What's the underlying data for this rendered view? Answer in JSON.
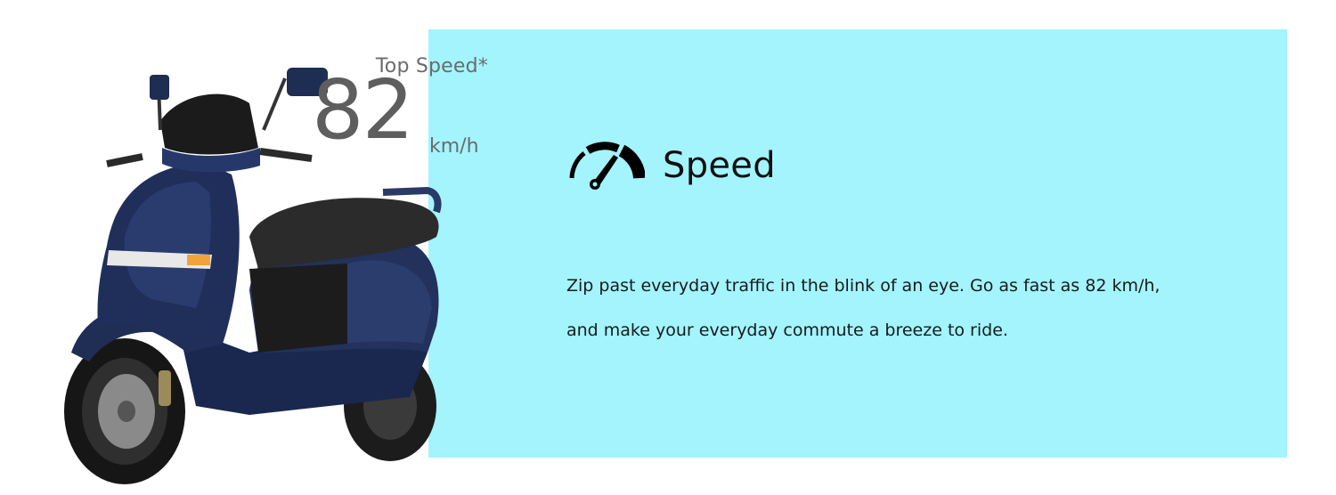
{
  "colors": {
    "panel": "#a3f4fd",
    "scooter_body": "#1e2d52",
    "seat": "#2a2a2a",
    "value_text": "#5e5e5e"
  },
  "stat": {
    "label": "Top Speed*",
    "value": "82",
    "unit": "km/h"
  },
  "feature": {
    "icon": "speedometer-icon",
    "title": "Speed",
    "description_line1": "Zip past everyday traffic in the blink of an eye. Go as  fast as 82 km/h,",
    "description_line2": "and make your everyday commute a breeze to ride."
  },
  "image": {
    "subject": "scooter-image"
  }
}
